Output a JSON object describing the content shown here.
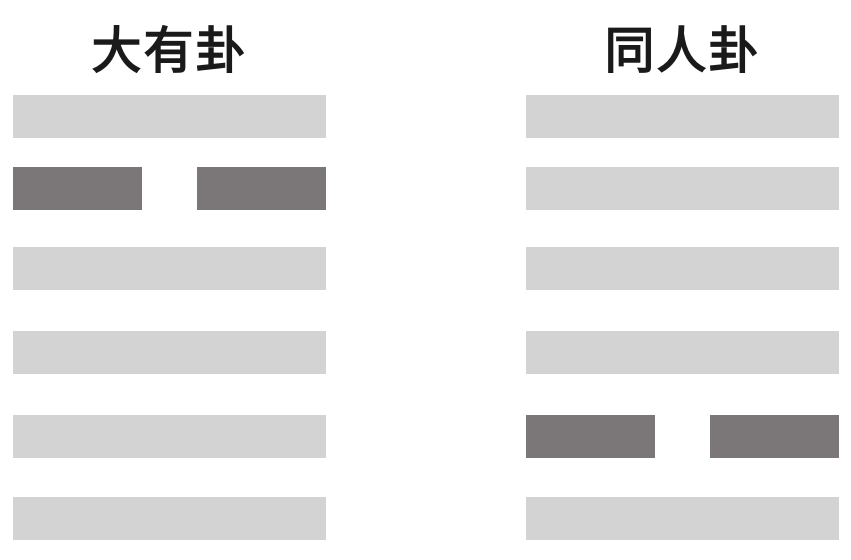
{
  "colors": {
    "yang": "#d3d3d3",
    "yin": "#7b7778"
  },
  "hexagrams": [
    {
      "title": "大有卦",
      "lines": [
        "yang",
        "yin",
        "yang",
        "yang",
        "yang",
        "yang"
      ]
    },
    {
      "title": "同人卦",
      "lines": [
        "yang",
        "yang",
        "yang",
        "yang",
        "yin",
        "yang"
      ]
    }
  ]
}
